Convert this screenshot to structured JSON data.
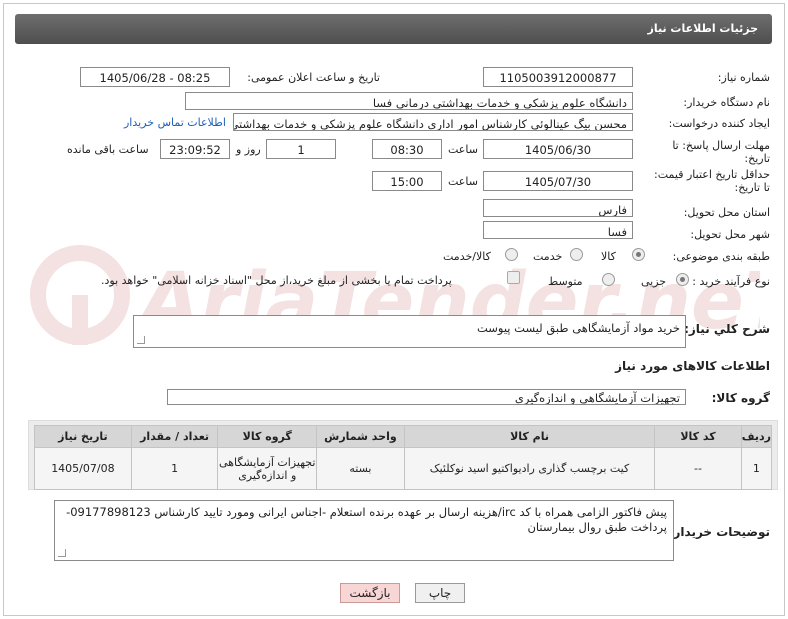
{
  "header": {
    "title": "جزئیات اطلاعات نیاز"
  },
  "fields": {
    "need_number_label": "شماره نیاز:",
    "need_number": "1105003912000877",
    "announce_label": "تاریخ و ساعت اعلان عمومی:",
    "announce_value": "1405/06/28 - 08:25",
    "buyer_org_label": "نام دستگاه خریدار:",
    "buyer_org": "دانشگاه علوم پزشکی و خدمات بهداشتی درمانی فسا",
    "creator_label": "ایجاد کننده درخواست:",
    "creator": "محسن بیگ عینالوئی کارشناس امور اداری دانشگاه علوم پزشکی و خدمات بهداشتی درمانی فسا",
    "contact_link": "اطلاعات تماس خریدار",
    "deadline_label_1": "مهلت ارسال پاسخ: تا",
    "deadline_label_2": "تاریخ:",
    "deadline_date": "1405/06/30",
    "time_label": "ساعت",
    "deadline_time": "08:30",
    "days_value": "1",
    "days_label": "روز و",
    "remaining_time": "23:09:52",
    "remaining_label": "ساعت باقی مانده",
    "price_validity_label_1": "حداقل تاریخ اعتبار قیمت:",
    "price_validity_label_2": "تا تاریخ:",
    "price_validity_date": "1405/07/30",
    "price_validity_time_label": "ساعت",
    "price_validity_time": "15:00",
    "province_label": "استان محل تحویل:",
    "province": "فارس",
    "city_label": "شهر محل تحویل:",
    "city": "فسا",
    "category_label": "طبقه بندی موضوعی:",
    "category_options": [
      "کالا",
      "خدمت",
      "کالا/خدمت"
    ],
    "category_selected": "کالا",
    "process_label": "نوع فرآیند خرید :",
    "process_options": [
      "جزیی",
      "متوسط"
    ],
    "process_selected": "جزیی",
    "treasury_text": "پرداخت تمام یا بخشی از مبلغ خرید،از محل \"اسناد خزانه اسلامی\" خواهد بود."
  },
  "description": {
    "label": "شرح کلي نياز:",
    "value": "خرید مواد آزمایشگاهی طبق لیست پیوست"
  },
  "goods_info": {
    "section_title": "اطلاعات کالاهای مورد نیاز",
    "group_label": "گروه کالا:",
    "group_value": "تجهیزات آزمایشگاهی و اندازه‌گیری"
  },
  "items_table": {
    "headers": [
      "ردیف",
      "کد کالا",
      "نام کالا",
      "واحد شمارش",
      "گروه کالا",
      "تعداد / مقدار",
      "تاریخ نیاز"
    ],
    "rows": [
      [
        "1",
        "--",
        "کیت برچسب گذاری رادیواکتیو اسید نوکلئیک",
        "بسته",
        "تجهیزات آزمایشگاهی و اندازه‌گیری",
        "1",
        "1405/07/08"
      ]
    ]
  },
  "buyer_notes": {
    "label": "توضیحات خریدار:",
    "value": "پیش فاکتور الزامی همراه با کد irc/هزینه ارسال بر عهده برنده استعلام -اجناس ایرانی ومورد تایید کارشناس 09177898123- پرداخت طبق روال بیمارستان"
  },
  "buttons": {
    "print": "چاپ",
    "back": "بازگشت"
  },
  "watermark": {
    "text": "AriaTender.neT"
  },
  "colors": {
    "header_bg": "#5a5a5a",
    "link": "#1f5fb8",
    "back_button_bg": "#f8d6d6",
    "watermark": "#b22222"
  }
}
